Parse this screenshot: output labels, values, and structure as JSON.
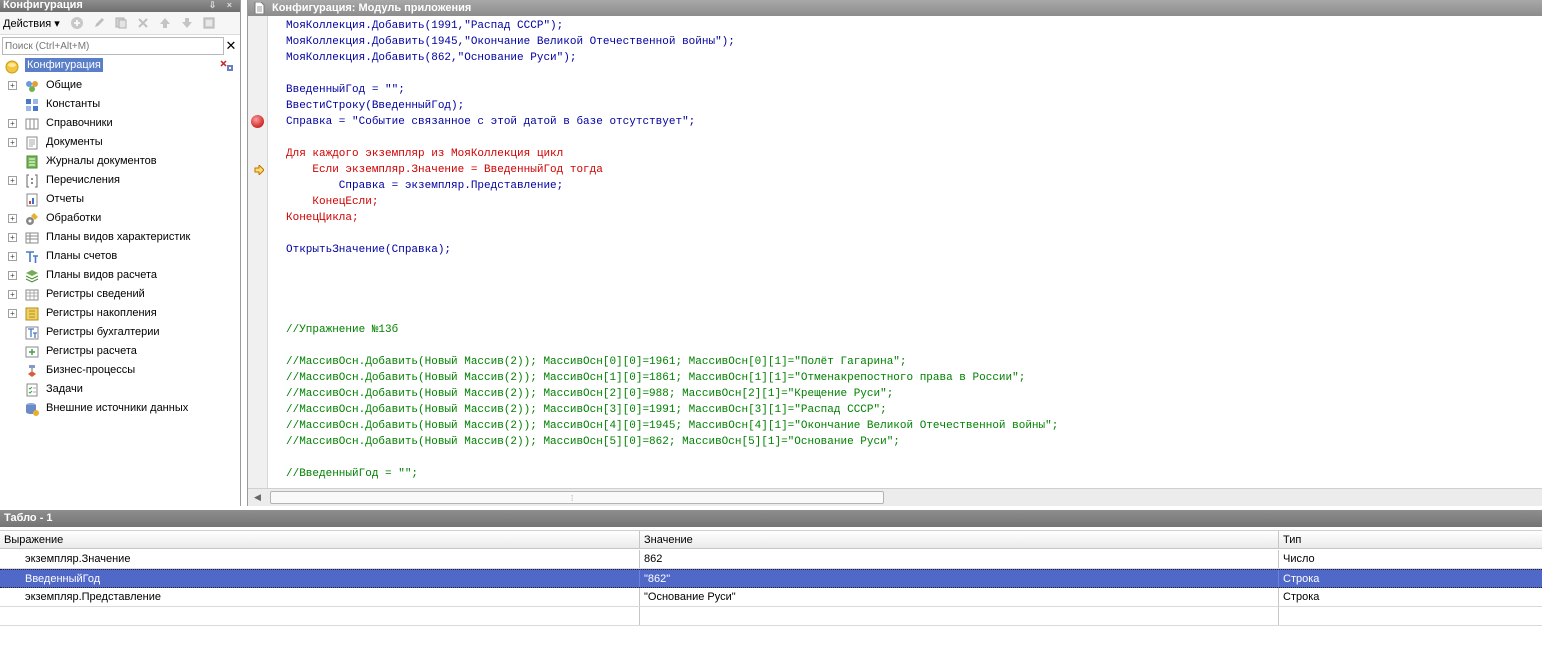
{
  "config_panel": {
    "title": "Конфигурация",
    "title_buttons": "⇩ ×",
    "actions_label": "Действия ▾",
    "search_placeholder": "Поиск (Ctrl+Alt+M)",
    "tree_root": "Конфигурация",
    "tree": [
      {
        "label": "Общие",
        "expandable": true,
        "icon": "common-icon"
      },
      {
        "label": "Константы",
        "expandable": false,
        "icon": "constants-icon"
      },
      {
        "label": "Справочники",
        "expandable": true,
        "icon": "catalogs-icon"
      },
      {
        "label": "Документы",
        "expandable": true,
        "icon": "documents-icon"
      },
      {
        "label": "Журналы документов",
        "expandable": false,
        "icon": "journals-icon"
      },
      {
        "label": "Перечисления",
        "expandable": true,
        "icon": "enums-icon"
      },
      {
        "label": "Отчеты",
        "expandable": false,
        "icon": "reports-icon"
      },
      {
        "label": "Обработки",
        "expandable": true,
        "icon": "processing-icon"
      },
      {
        "label": "Планы видов характеристик",
        "expandable": true,
        "icon": "chart-of-characteristics-icon"
      },
      {
        "label": "Планы счетов",
        "expandable": true,
        "icon": "chart-of-accounts-icon"
      },
      {
        "label": "Планы видов расчета",
        "expandable": true,
        "icon": "calculation-types-icon"
      },
      {
        "label": "Регистры сведений",
        "expandable": true,
        "icon": "info-registers-icon"
      },
      {
        "label": "Регистры накопления",
        "expandable": true,
        "icon": "accumulation-registers-icon"
      },
      {
        "label": "Регистры бухгалтерии",
        "expandable": false,
        "icon": "accounting-registers-icon"
      },
      {
        "label": "Регистры расчета",
        "expandable": false,
        "icon": "calculation-registers-icon"
      },
      {
        "label": "Бизнес-процессы",
        "expandable": false,
        "icon": "business-processes-icon"
      },
      {
        "label": "Задачи",
        "expandable": false,
        "icon": "tasks-icon"
      },
      {
        "label": "Внешние источники данных",
        "expandable": false,
        "icon": "external-sources-icon"
      }
    ]
  },
  "editor": {
    "title": "Конфигурация: Модуль приложения",
    "lines": [
      {
        "text": "МояКоллекция.Добавить(1991,\"Распад СССР\");",
        "color": "blue"
      },
      {
        "text": "МояКоллекция.Добавить(1945,\"Окончание Великой Отечественной войны\");",
        "color": "blue"
      },
      {
        "text": "МояКоллекция.Добавить(862,\"Основание Руси\");",
        "color": "blue"
      },
      {
        "text": "",
        "color": "black"
      },
      {
        "text": "ВведенныйГод = \"\";",
        "color": "blue"
      },
      {
        "text": "ВвестиСтроку(ВведенныйГод);",
        "color": "blue"
      },
      {
        "text": "Справка = \"Событие связанное с этой датой в базе отсутствует\";",
        "color": "blue",
        "breakpoint": true
      },
      {
        "text": "",
        "color": "black"
      },
      {
        "text": "Для каждого экземпляр из МояКоллекция цикл",
        "color": "red"
      },
      {
        "text": "    Если экземпляр.Значение = ВведенныйГод тогда",
        "color": "red",
        "current": true
      },
      {
        "text": "        Справка = экземпляр.Представление;",
        "color": "blue"
      },
      {
        "text": "    КонецЕсли;",
        "color": "red"
      },
      {
        "text": "КонецЦикла;",
        "color": "red"
      },
      {
        "text": "",
        "color": "black"
      },
      {
        "text": "ОткрытьЗначение(Справка);",
        "color": "blue"
      },
      {
        "text": "",
        "color": "black"
      },
      {
        "text": "",
        "color": "black"
      },
      {
        "text": "",
        "color": "black"
      },
      {
        "text": "",
        "color": "black"
      },
      {
        "text": "//Упражнение №13б",
        "color": "green"
      },
      {
        "text": "",
        "color": "black"
      },
      {
        "text": "//МассивОсн.Добавить(Новый Массив(2)); МассивОсн[0][0]=1961; МассивОсн[0][1]=\"Полёт Гагарина\";",
        "color": "green"
      },
      {
        "text": "//МассивОсн.Добавить(Новый Массив(2)); МассивОсн[1][0]=1861; МассивОсн[1][1]=\"Отменакрепостного права в России\";",
        "color": "green"
      },
      {
        "text": "//МассивОсн.Добавить(Новый Массив(2)); МассивОсн[2][0]=988; МассивОсн[2][1]=\"Крещение Руси\";",
        "color": "green"
      },
      {
        "text": "//МассивОсн.Добавить(Новый Массив(2)); МассивОсн[3][0]=1991; МассивОсн[3][1]=\"Распад СССР\";",
        "color": "green"
      },
      {
        "text": "//МассивОсн.Добавить(Новый Массив(2)); МассивОсн[4][0]=1945; МассивОсн[4][1]=\"Окончание Великой Отечественной войны\";",
        "color": "green"
      },
      {
        "text": "//МассивОсн.Добавить(Новый Массив(2)); МассивОсн[5][0]=862; МассивОсн[5][1]=\"Основание Руси\";",
        "color": "green"
      },
      {
        "text": "",
        "color": "black"
      },
      {
        "text": "//ВведенныйГод = \"\";",
        "color": "green"
      }
    ]
  },
  "watch": {
    "title": "Табло - 1",
    "columns": [
      "Выражение",
      "Значение",
      "Тип"
    ],
    "rows": [
      {
        "expression": "экземпляр.Значение",
        "value": "862",
        "type": "Число",
        "selected": false
      },
      {
        "expression": "ВведенныйГод",
        "value": "\"862\"",
        "type": "Строка",
        "selected": true
      },
      {
        "expression": "экземпляр.Представление",
        "value": "\"Основание Руси\"",
        "type": "Строка",
        "selected": false
      },
      {
        "expression": "",
        "value": "",
        "type": "",
        "selected": false
      }
    ]
  },
  "colors": {
    "keyword_red": "#d00000",
    "code_blue": "#0000a0",
    "comment_green": "#008000",
    "selection": "#5068c8"
  }
}
